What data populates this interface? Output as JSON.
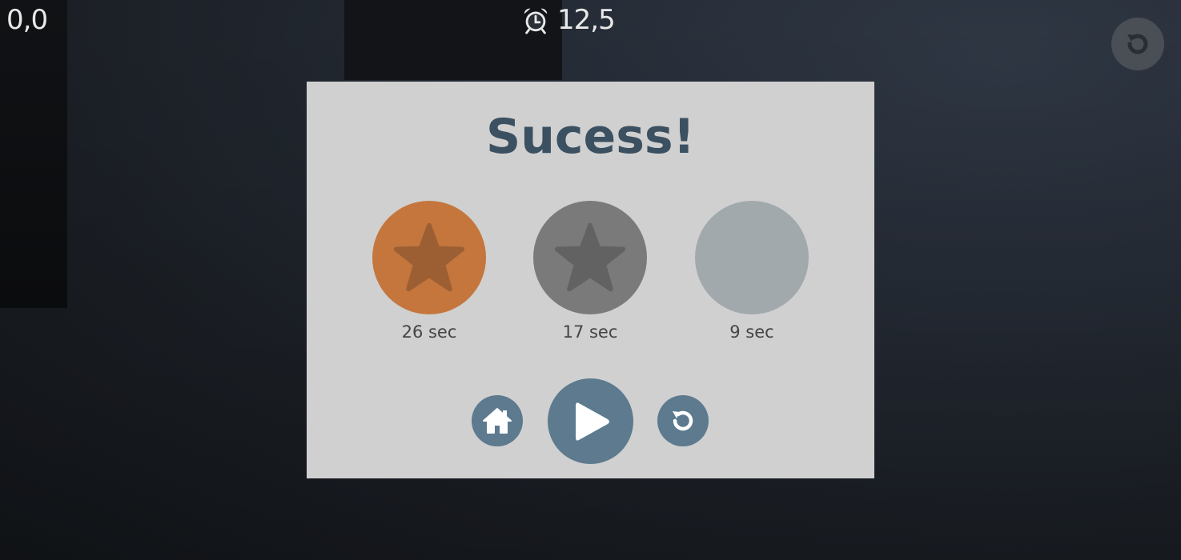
{
  "hud": {
    "score": "0,0",
    "timer": "12,5",
    "timer_icon": "alarm-clock-icon",
    "restart_icon": "restart-icon"
  },
  "dialog": {
    "title": "Sucess!",
    "stars": [
      {
        "label": "26 sec",
        "earned": true,
        "tier": "bronze",
        "color": "#c5763d",
        "star_color": "#9c5f33"
      },
      {
        "label": "17 sec",
        "earned": true,
        "tier": "silver",
        "color": "#7a7a7a",
        "star_color": "#626262"
      },
      {
        "label": "9 sec",
        "earned": false,
        "tier": "gold",
        "color": "#a2a9ad",
        "star_color": ""
      }
    ],
    "buttons": {
      "home_icon": "home-icon",
      "play_icon": "play-icon",
      "restart_icon": "restart-icon"
    }
  },
  "colors": {
    "title": "#3b5061",
    "button": "#5d7a8e",
    "dialog_bg": "#d0d0d0"
  }
}
